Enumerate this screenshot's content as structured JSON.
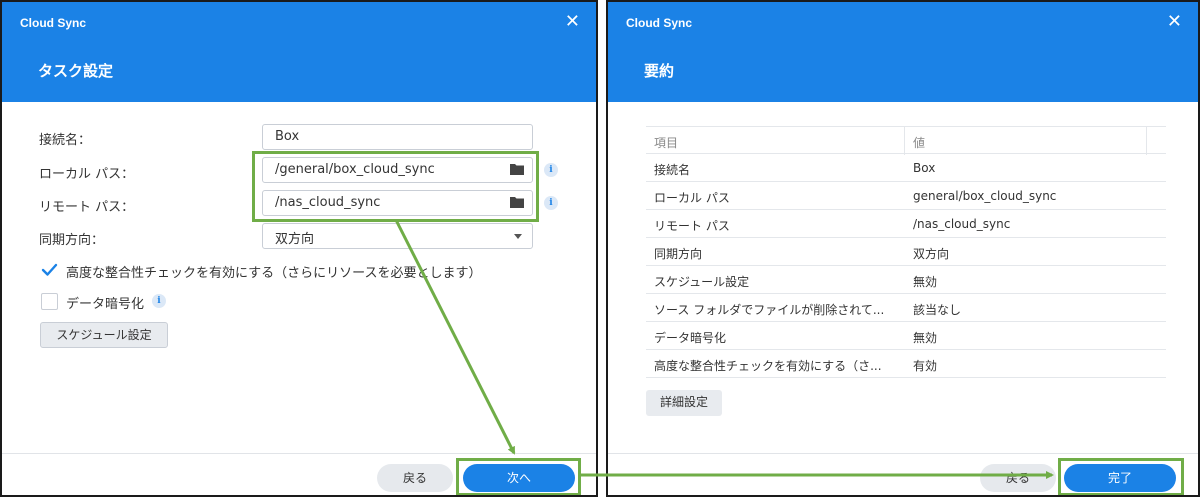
{
  "left_dialog": {
    "app_title": "Cloud Sync",
    "page_title": "タスク設定",
    "connection_name_label": "接続名：",
    "connection_name_value": "Box",
    "local_path_label": "ローカル パス：",
    "local_path_value": "/general/box_cloud_sync",
    "remote_path_label": "リモート パス：",
    "remote_path_value": "/nas_cloud_sync",
    "sync_direction_label": "同期方向：",
    "sync_direction_value": "双方向",
    "integrity_check_label": "高度な整合性チェックを有効にする（さらにリソースを必要とします）",
    "integrity_check_checked": true,
    "encryption_label": "データ暗号化",
    "encryption_checked": false,
    "schedule_button": "スケジュール設定",
    "back_button": "戻る",
    "next_button": "次へ"
  },
  "right_dialog": {
    "app_title": "Cloud Sync",
    "page_title": "要約",
    "table": {
      "headers": [
        "項目",
        "値"
      ],
      "rows": [
        [
          "接続名",
          "Box"
        ],
        [
          "ローカル パス",
          "general/box_cloud_sync"
        ],
        [
          "リモート パス",
          "/nas_cloud_sync"
        ],
        [
          "同期方向",
          "双方向"
        ],
        [
          "スケジュール設定",
          "無効"
        ],
        [
          "ソース フォルダでファイルが削除されて...",
          "該当なし"
        ],
        [
          "データ暗号化",
          "無効"
        ],
        [
          "高度な整合性チェックを有効にする（さ...",
          "有効"
        ]
      ]
    },
    "advanced_button": "詳細設定",
    "back_button": "戻る",
    "finish_button": "完了"
  },
  "icons": {
    "close": "close-icon",
    "folder": "folder-icon",
    "info": "info-icon",
    "dropdown": "chevron-down-icon",
    "check": "checkmark-icon"
  },
  "colors": {
    "header_blue": "#1b82e6",
    "highlight_green": "#70ad47"
  }
}
